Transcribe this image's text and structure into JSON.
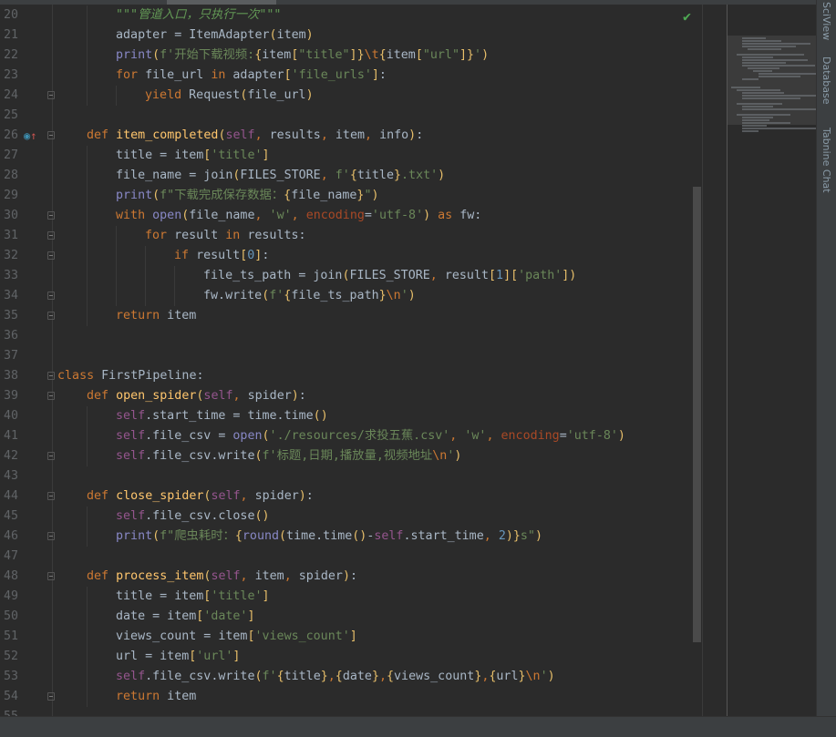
{
  "editor": {
    "status_icon": "check-icon",
    "colors": {
      "keyword": "#cc7832",
      "string": "#6a8759",
      "self": "#94558d",
      "function": "#ffc66d",
      "builtin": "#8888c6",
      "number": "#6897bb",
      "text": "#a9b7c6",
      "param": "#aa4926",
      "docstring": "#629755",
      "background": "#2b2b2b"
    },
    "lines": [
      {
        "n": "20",
        "indent": 8,
        "tokens": [
          [
            "d",
            "\"\"\"管道入口，只执行一次\"\"\""
          ]
        ]
      },
      {
        "n": "21",
        "indent": 8,
        "tokens": [
          [
            "t",
            "adapter = ItemAdapter"
          ],
          [
            "br",
            "("
          ],
          [
            "t",
            "item"
          ],
          [
            "br",
            ")"
          ]
        ]
      },
      {
        "n": "22",
        "indent": 8,
        "tokens": [
          [
            "b",
            "print"
          ],
          [
            "br",
            "("
          ],
          [
            "s",
            "f'开始下载视频:"
          ],
          [
            "br",
            "{"
          ],
          [
            "t",
            "item"
          ],
          [
            "br",
            "["
          ],
          [
            "s",
            "\"title\""
          ],
          [
            "br",
            "]}"
          ],
          [
            "e",
            "\\t"
          ],
          [
            "br",
            "{"
          ],
          [
            "t",
            "item"
          ],
          [
            "br",
            "["
          ],
          [
            "s",
            "\"url\""
          ],
          [
            "br",
            "]}"
          ],
          [
            "s",
            "'"
          ],
          [
            "br",
            ")"
          ]
        ]
      },
      {
        "n": "23",
        "indent": 8,
        "tokens": [
          [
            "k",
            "for "
          ],
          [
            "t",
            "file_url "
          ],
          [
            "k",
            "in "
          ],
          [
            "t",
            "adapter"
          ],
          [
            "br",
            "["
          ],
          [
            "s",
            "'file_urls'"
          ],
          [
            "br",
            "]"
          ],
          [
            "t",
            ":"
          ]
        ]
      },
      {
        "n": "24",
        "indent": 12,
        "fold": true,
        "tokens": [
          [
            "k",
            "yield "
          ],
          [
            "t",
            "Request"
          ],
          [
            "br",
            "("
          ],
          [
            "t",
            "file_url"
          ],
          [
            "br",
            ")"
          ]
        ]
      },
      {
        "n": "25",
        "indent": 0,
        "tokens": []
      },
      {
        "n": "26",
        "indent": 4,
        "fold": true,
        "override": true,
        "tokens": [
          [
            "k",
            "def "
          ],
          [
            "fn",
            "item_completed"
          ],
          [
            "br",
            "("
          ],
          [
            "sf",
            "self"
          ],
          [
            "k",
            ", "
          ],
          [
            "t",
            "results"
          ],
          [
            "k",
            ", "
          ],
          [
            "t",
            "item"
          ],
          [
            "k",
            ", "
          ],
          [
            "t",
            "info"
          ],
          [
            "br",
            ")"
          ],
          [
            "t",
            ":"
          ]
        ]
      },
      {
        "n": "27",
        "indent": 8,
        "tokens": [
          [
            "t",
            "title = item"
          ],
          [
            "br",
            "["
          ],
          [
            "s",
            "'title'"
          ],
          [
            "br",
            "]"
          ]
        ]
      },
      {
        "n": "28",
        "indent": 8,
        "tokens": [
          [
            "t",
            "file_name = join"
          ],
          [
            "br",
            "("
          ],
          [
            "t",
            "FILES_STORE"
          ],
          [
            "k",
            ", "
          ],
          [
            "s",
            "f'"
          ],
          [
            "br",
            "{"
          ],
          [
            "t",
            "title"
          ],
          [
            "br",
            "}"
          ],
          [
            "s",
            ".txt'"
          ],
          [
            "br",
            ")"
          ]
        ]
      },
      {
        "n": "29",
        "indent": 8,
        "tokens": [
          [
            "b",
            "print"
          ],
          [
            "br",
            "("
          ],
          [
            "s",
            "f\"下载完成保存数据："
          ],
          [
            "br",
            "{"
          ],
          [
            "t",
            "file_name"
          ],
          [
            "br",
            "}"
          ],
          [
            "s",
            "\""
          ],
          [
            "br",
            ")"
          ]
        ]
      },
      {
        "n": "30",
        "indent": 8,
        "fold": true,
        "tokens": [
          [
            "k",
            "with "
          ],
          [
            "b",
            "open"
          ],
          [
            "br",
            "("
          ],
          [
            "t",
            "file_name"
          ],
          [
            "k",
            ", "
          ],
          [
            "s",
            "'w'"
          ],
          [
            "k",
            ", "
          ],
          [
            "p",
            "encoding"
          ],
          [
            "t",
            "="
          ],
          [
            "s",
            "'utf-8'"
          ],
          [
            "br",
            ")"
          ],
          [
            "k",
            " as "
          ],
          [
            "t",
            "fw:"
          ]
        ]
      },
      {
        "n": "31",
        "indent": 12,
        "fold": true,
        "tokens": [
          [
            "k",
            "for "
          ],
          [
            "t",
            "result "
          ],
          [
            "k",
            "in "
          ],
          [
            "t",
            "results:"
          ]
        ]
      },
      {
        "n": "32",
        "indent": 16,
        "fold": true,
        "tokens": [
          [
            "k",
            "if "
          ],
          [
            "t",
            "result"
          ],
          [
            "br",
            "["
          ],
          [
            "n",
            "0"
          ],
          [
            "br",
            "]"
          ],
          [
            "t",
            ":"
          ]
        ]
      },
      {
        "n": "33",
        "indent": 20,
        "tokens": [
          [
            "t",
            "file_ts_path = join"
          ],
          [
            "br",
            "("
          ],
          [
            "t",
            "FILES_STORE"
          ],
          [
            "k",
            ", "
          ],
          [
            "t",
            "result"
          ],
          [
            "br",
            "["
          ],
          [
            "n",
            "1"
          ],
          [
            "br",
            "]["
          ],
          [
            "s",
            "'path'"
          ],
          [
            "br",
            "])"
          ]
        ]
      },
      {
        "n": "34",
        "indent": 20,
        "fold": true,
        "tokens": [
          [
            "t",
            "fw.write"
          ],
          [
            "br",
            "("
          ],
          [
            "s",
            "f'"
          ],
          [
            "br",
            "{"
          ],
          [
            "t",
            "file_ts_path"
          ],
          [
            "br",
            "}"
          ],
          [
            "e",
            "\\n"
          ],
          [
            "s",
            "'"
          ],
          [
            "br",
            ")"
          ]
        ]
      },
      {
        "n": "35",
        "indent": 8,
        "fold": true,
        "tokens": [
          [
            "k",
            "return "
          ],
          [
            "t",
            "item"
          ]
        ]
      },
      {
        "n": "36",
        "indent": 0,
        "tokens": []
      },
      {
        "n": "37",
        "indent": 0,
        "tokens": []
      },
      {
        "n": "38",
        "indent": 0,
        "fold": true,
        "tokens": [
          [
            "k",
            "class "
          ],
          [
            "t",
            "FirstPipeline:"
          ]
        ]
      },
      {
        "n": "39",
        "indent": 4,
        "fold": true,
        "tokens": [
          [
            "k",
            "def "
          ],
          [
            "fn",
            "open_spider"
          ],
          [
            "br",
            "("
          ],
          [
            "sf",
            "self"
          ],
          [
            "k",
            ", "
          ],
          [
            "t",
            "spider"
          ],
          [
            "br",
            ")"
          ],
          [
            "t",
            ":"
          ]
        ]
      },
      {
        "n": "40",
        "indent": 8,
        "tokens": [
          [
            "sf",
            "self"
          ],
          [
            "t",
            ".start_time = time.time"
          ],
          [
            "br",
            "()"
          ]
        ]
      },
      {
        "n": "41",
        "indent": 8,
        "tokens": [
          [
            "sf",
            "self"
          ],
          [
            "t",
            ".file_csv = "
          ],
          [
            "b",
            "open"
          ],
          [
            "br",
            "("
          ],
          [
            "s",
            "'./resources/求投五蕉.csv'"
          ],
          [
            "k",
            ", "
          ],
          [
            "s",
            "'w'"
          ],
          [
            "k",
            ", "
          ],
          [
            "p",
            "encoding"
          ],
          [
            "t",
            "="
          ],
          [
            "s",
            "'utf-8'"
          ],
          [
            "br",
            ")"
          ]
        ]
      },
      {
        "n": "42",
        "indent": 8,
        "fold": true,
        "tokens": [
          [
            "sf",
            "self"
          ],
          [
            "t",
            ".file_csv.write"
          ],
          [
            "br",
            "("
          ],
          [
            "s",
            "f'标题,日期,播放量,视频地址"
          ],
          [
            "e",
            "\\n"
          ],
          [
            "s",
            "'"
          ],
          [
            "br",
            ")"
          ]
        ]
      },
      {
        "n": "43",
        "indent": 0,
        "tokens": []
      },
      {
        "n": "44",
        "indent": 4,
        "fold": true,
        "tokens": [
          [
            "k",
            "def "
          ],
          [
            "fn",
            "close_spider"
          ],
          [
            "br",
            "("
          ],
          [
            "sf",
            "self"
          ],
          [
            "k",
            ", "
          ],
          [
            "t",
            "spider"
          ],
          [
            "br",
            ")"
          ],
          [
            "t",
            ":"
          ]
        ]
      },
      {
        "n": "45",
        "indent": 8,
        "tokens": [
          [
            "sf",
            "self"
          ],
          [
            "t",
            ".file_csv.close"
          ],
          [
            "br",
            "()"
          ]
        ]
      },
      {
        "n": "46",
        "indent": 8,
        "fold": true,
        "tokens": [
          [
            "b",
            "print"
          ],
          [
            "br",
            "("
          ],
          [
            "s",
            "f\"爬虫耗时："
          ],
          [
            "br",
            "{"
          ],
          [
            "b",
            "round"
          ],
          [
            "br",
            "("
          ],
          [
            "t",
            "time.time"
          ],
          [
            "br",
            "()"
          ],
          [
            "t",
            "-"
          ],
          [
            "sf",
            "self"
          ],
          [
            "t",
            ".start_time"
          ],
          [
            "k",
            ", "
          ],
          [
            "n",
            "2"
          ],
          [
            "br",
            ")}"
          ],
          [
            "s",
            "s\""
          ],
          [
            "br",
            ")"
          ]
        ]
      },
      {
        "n": "47",
        "indent": 0,
        "tokens": []
      },
      {
        "n": "48",
        "indent": 4,
        "fold": true,
        "tokens": [
          [
            "k",
            "def "
          ],
          [
            "fn",
            "process_item"
          ],
          [
            "br",
            "("
          ],
          [
            "sf",
            "self"
          ],
          [
            "k",
            ", "
          ],
          [
            "t",
            "item"
          ],
          [
            "k",
            ", "
          ],
          [
            "t",
            "spider"
          ],
          [
            "br",
            ")"
          ],
          [
            "t",
            ":"
          ]
        ]
      },
      {
        "n": "49",
        "indent": 8,
        "tokens": [
          [
            "t",
            "title = item"
          ],
          [
            "br",
            "["
          ],
          [
            "s",
            "'title'"
          ],
          [
            "br",
            "]"
          ]
        ]
      },
      {
        "n": "50",
        "indent": 8,
        "tokens": [
          [
            "t",
            "date = item"
          ],
          [
            "br",
            "["
          ],
          [
            "s",
            "'date'"
          ],
          [
            "br",
            "]"
          ]
        ]
      },
      {
        "n": "51",
        "indent": 8,
        "tokens": [
          [
            "t",
            "views_count = item"
          ],
          [
            "br",
            "["
          ],
          [
            "s",
            "'views_count'"
          ],
          [
            "br",
            "]"
          ]
        ]
      },
      {
        "n": "52",
        "indent": 8,
        "tokens": [
          [
            "t",
            "url = item"
          ],
          [
            "br",
            "["
          ],
          [
            "s",
            "'url'"
          ],
          [
            "br",
            "]"
          ]
        ]
      },
      {
        "n": "53",
        "indent": 8,
        "tokens": [
          [
            "sf",
            "self"
          ],
          [
            "t",
            ".file_csv.write"
          ],
          [
            "br",
            "("
          ],
          [
            "s",
            "f'"
          ],
          [
            "br",
            "{"
          ],
          [
            "t",
            "title"
          ],
          [
            "br",
            "}"
          ],
          [
            "k",
            ","
          ],
          [
            "br",
            "{"
          ],
          [
            "t",
            "date"
          ],
          [
            "br",
            "}"
          ],
          [
            "k",
            ","
          ],
          [
            "br",
            "{"
          ],
          [
            "t",
            "views_count"
          ],
          [
            "br",
            "}"
          ],
          [
            "k",
            ","
          ],
          [
            "br",
            "{"
          ],
          [
            "t",
            "url"
          ],
          [
            "br",
            "}"
          ],
          [
            "e",
            "\\n"
          ],
          [
            "s",
            "'"
          ],
          [
            "br",
            ")"
          ]
        ]
      },
      {
        "n": "54",
        "indent": 8,
        "fold": true,
        "tokens": [
          [
            "k",
            "return "
          ],
          [
            "t",
            "item"
          ]
        ]
      },
      {
        "n": "55",
        "indent": 0,
        "tokens": []
      }
    ]
  },
  "right_toolbar": {
    "tabs": [
      "SciView",
      "Database",
      "Tabnine Chat"
    ]
  }
}
